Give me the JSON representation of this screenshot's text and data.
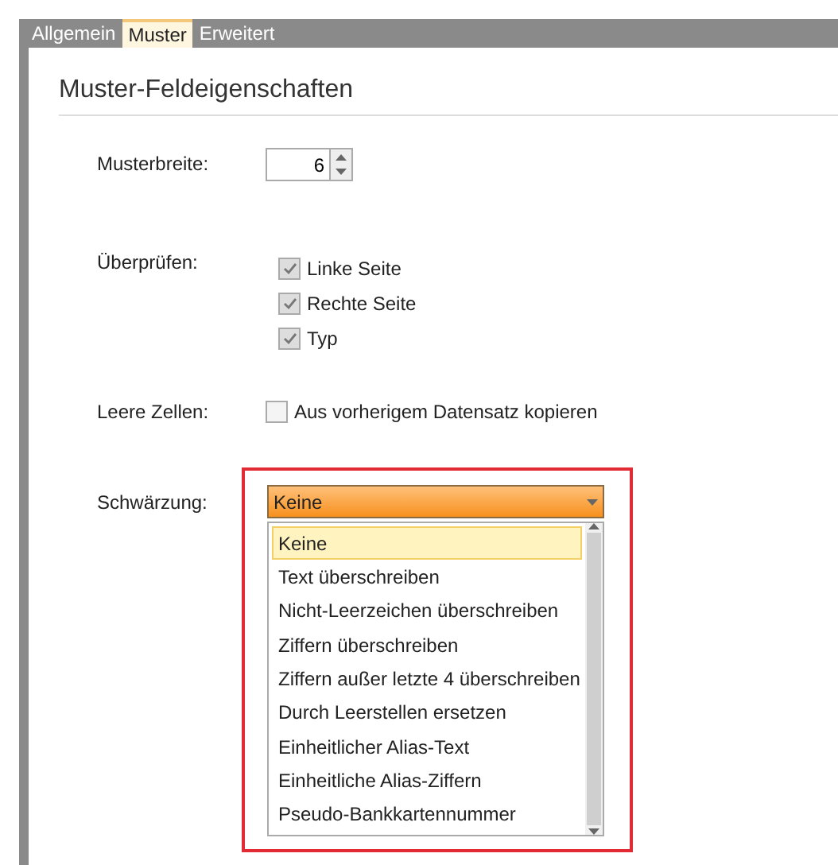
{
  "tabs": [
    {
      "label": "Allgemein",
      "selected": false
    },
    {
      "label": "Muster",
      "selected": true
    },
    {
      "label": "Erweitert",
      "selected": false
    }
  ],
  "heading": "Muster-Feldeigenschaften",
  "pattern_width": {
    "label": "Musterbreite:",
    "value": "6"
  },
  "check": {
    "label": "Überprüfen:",
    "options": [
      {
        "label": "Linke Seite",
        "checked": true,
        "disabled": true
      },
      {
        "label": "Rechte Seite",
        "checked": true,
        "disabled": true
      },
      {
        "label": "Typ",
        "checked": true,
        "disabled": true
      }
    ]
  },
  "empty_cells": {
    "label": "Leere Zellen:",
    "option": {
      "label": "Aus vorherigem Datensatz kopieren",
      "checked": false,
      "disabled": false
    }
  },
  "redaction": {
    "label": "Schwärzung:",
    "value": "Keine",
    "highlighted": true,
    "options": [
      {
        "label": "Keine",
        "selected": true
      },
      {
        "label": "Text überschreiben",
        "selected": false
      },
      {
        "label": "Nicht-Leerzeichen überschreiben",
        "selected": false
      },
      {
        "label": "Ziffern überschreiben",
        "selected": false
      },
      {
        "label": "Ziffern außer letzte 4 überschreiben",
        "selected": false
      },
      {
        "label": "Durch Leerstellen ersetzen",
        "selected": false
      },
      {
        "label": "Einheitlicher Alias-Text",
        "selected": false
      },
      {
        "label": "Einheitliche Alias-Ziffern",
        "selected": false
      },
      {
        "label": "Pseudo-Bankkartennummer",
        "selected": false
      }
    ]
  }
}
